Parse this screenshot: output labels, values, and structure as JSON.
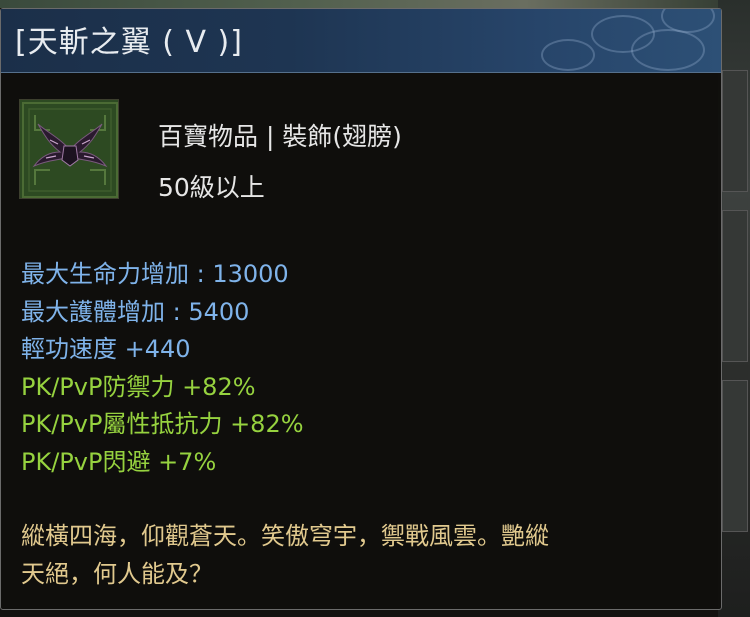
{
  "tooltip": {
    "title": "[天斬之翼 ( V )]",
    "item_type": "百寶物品 | 裝飾(翅膀)",
    "level_requirement": "50級以上",
    "icon": "dark-wings-icon",
    "stats": [
      {
        "text": "最大生命力增加 : 13000",
        "color": "#7fb3ea"
      },
      {
        "text": "最大護體增加 : 5400",
        "color": "#7fb3ea"
      },
      {
        "text": "輕功速度 +440",
        "color": "#7fb3ea"
      },
      {
        "text": "PK/PvP防禦力 +82%",
        "color": "#96d23f"
      },
      {
        "text": "PK/PvP屬性抵抗力 +82%",
        "color": "#96d23f"
      },
      {
        "text": "PK/PvP閃避 +7%",
        "color": "#96d23f"
      }
    ],
    "description_lines": [
      "縱橫四海，仰觀蒼天。笑傲穹宇，禦戰風雲。艷縱",
      "天絕，何人能及？"
    ],
    "colors": {
      "title_bar": "#1e3552",
      "stat_blue": "#7fb3ea",
      "stat_green": "#96d23f",
      "description": "#e1c98e"
    }
  }
}
